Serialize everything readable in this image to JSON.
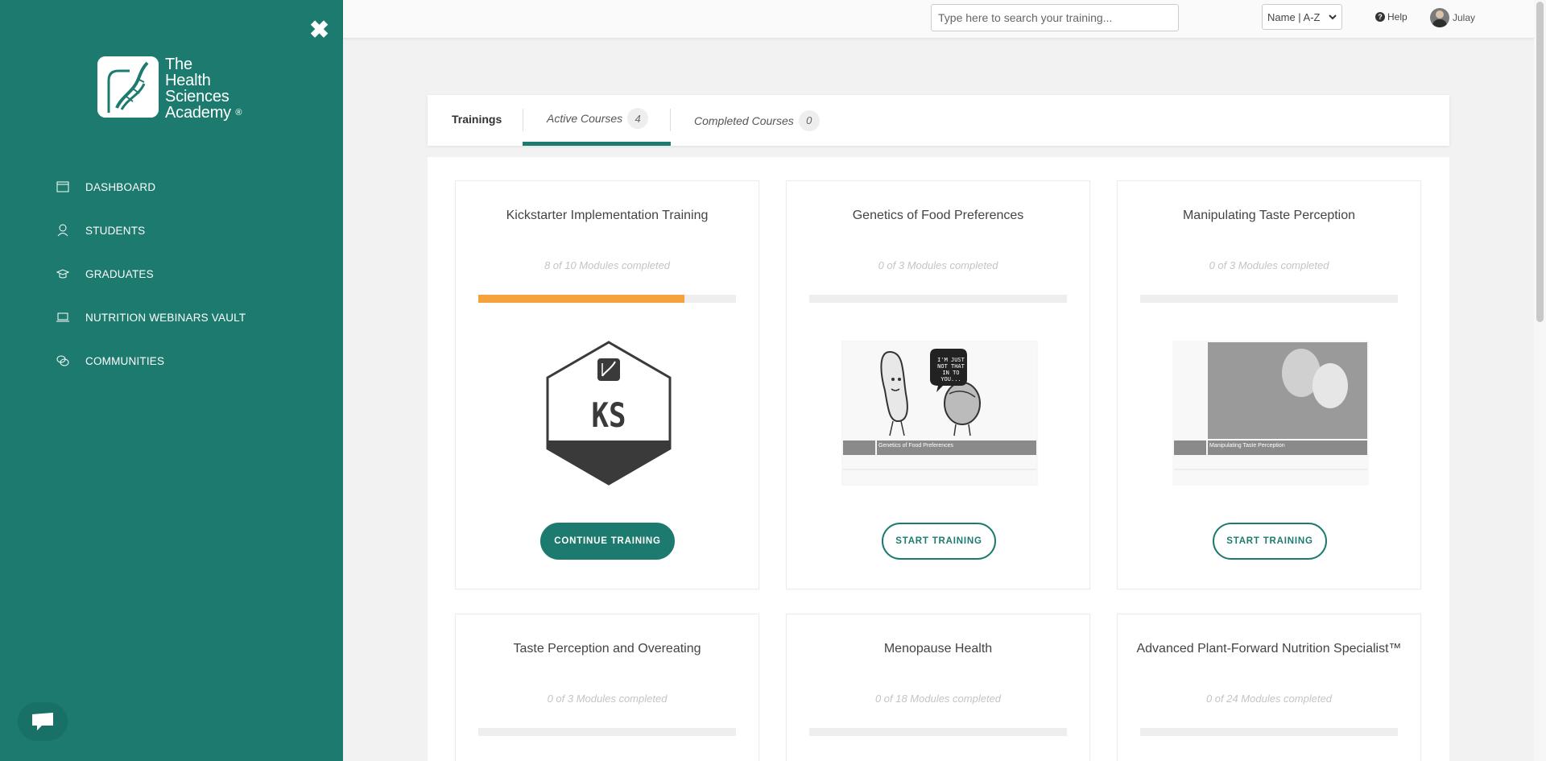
{
  "sidebar": {
    "logo": {
      "line1": "The",
      "line2": "Health",
      "line3": "Sciences",
      "line4": "Academy",
      "reg": "®"
    },
    "close_glyph": "✖",
    "items": [
      {
        "label": "DASHBOARD",
        "icon": "calendar-icon"
      },
      {
        "label": "STUDENTS",
        "icon": "user-icon"
      },
      {
        "label": "GRADUATES",
        "icon": "graduation-cap-icon"
      },
      {
        "label": "NUTRITION WEBINARS VAULT",
        "icon": "laptop-icon"
      },
      {
        "label": "COMMUNITIES",
        "icon": "chat-bubbles-icon"
      }
    ]
  },
  "topbar": {
    "search_placeholder": "Type here to search your training...",
    "sort_value": "Name | A-Z",
    "help_label": "Help",
    "user_name": "Julay"
  },
  "tabs": {
    "title": "Trainings",
    "items": [
      {
        "label": "Active Courses",
        "count": "4"
      },
      {
        "label": "Completed Courses",
        "count": "0"
      }
    ]
  },
  "courses": [
    {
      "title": "Kickstarter Implementation Training",
      "progress_text": "8 of 10 Modules completed",
      "progress": 0.8,
      "button": "CONTINUE TRAINING",
      "badge_text": "KS"
    },
    {
      "title": "Genetics of Food Preferences",
      "progress_text": "0 of 3 Modules completed",
      "progress": 0,
      "button": "START TRAINING",
      "thumb_caption": "Genetics of Food Preferences",
      "speech": "I'M JUST NOT THAT IN TO YOU..."
    },
    {
      "title": "Manipulating Taste Perception",
      "progress_text": "0 of 3 Modules completed",
      "progress": 0,
      "button": "START TRAINING",
      "thumb_caption": "Manipulating Taste Perception"
    },
    {
      "title": "Taste Perception and Overeating",
      "progress_text": "0 of 3 Modules completed",
      "progress": 0
    },
    {
      "title": "Menopause Health",
      "progress_text": "0 of 18 Modules completed",
      "progress": 0
    },
    {
      "title": "Advanced Plant-Forward Nutrition Specialist™",
      "progress_text": "0 of 24 Modules completed",
      "progress": 0
    }
  ],
  "colors": {
    "brand": "#1c7b6e",
    "progress": "#f6a23c"
  }
}
